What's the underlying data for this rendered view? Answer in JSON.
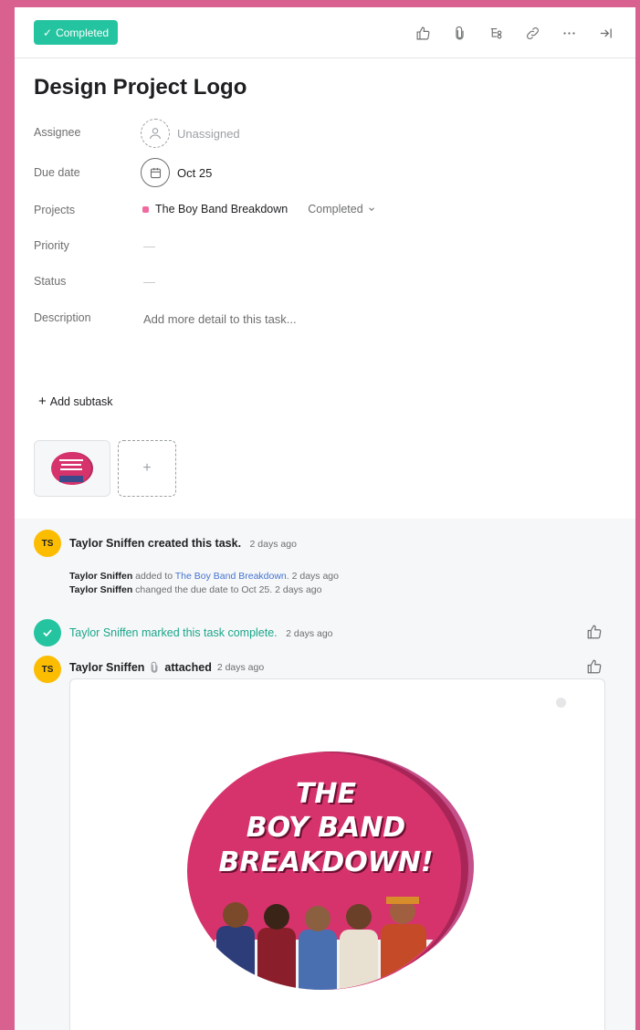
{
  "header": {
    "complete_label": "Completed",
    "toolbar_icons": [
      "thumbs-up-icon",
      "paperclip-icon",
      "subtask-icon",
      "link-icon",
      "more-icon",
      "close-panel-icon"
    ]
  },
  "task": {
    "title": "Design Project Logo",
    "fields": {
      "assignee_label": "Assignee",
      "assignee_value": "Unassigned",
      "due_label": "Due date",
      "due_value": "Oct 25",
      "projects_label": "Projects",
      "project_name": "The Boy Band Breakdown",
      "project_section": "Completed",
      "priority_label": "Priority",
      "priority_value": "—",
      "status_label": "Status",
      "status_value": "—",
      "description_label": "Description",
      "description_placeholder": "Add more detail to this task..."
    },
    "add_subtask": "Add subtask",
    "add_attachment": "+"
  },
  "activity": {
    "user_initials": "TS",
    "created_user": "Taylor Sniffen",
    "created_text": "created this task.",
    "created_time": "2 days ago",
    "sub1_user": "Taylor Sniffen",
    "sub1_text": "added to",
    "sub1_link": "The Boy Band Breakdown",
    "sub1_time": "2 days ago",
    "sub2_user": "Taylor Sniffen",
    "sub2_text": "changed the due date to Oct 25.",
    "sub2_time": "2 days ago",
    "complete_text": "Taylor Sniffen marked this task complete.",
    "complete_time": "2 days ago",
    "attached_user": "Taylor Sniffen",
    "attached_text": "attached",
    "attached_time": "2 days ago"
  },
  "image": {
    "line1": "THE",
    "line2": "BOY BAND",
    "line3": "BREAKDOWN!"
  },
  "colors": {
    "accent": "#25c4a0",
    "background": "#d9618f",
    "project_dot": "#f06a9f",
    "avatar": "#fcbd01",
    "logo_pink": "#d6336c"
  }
}
